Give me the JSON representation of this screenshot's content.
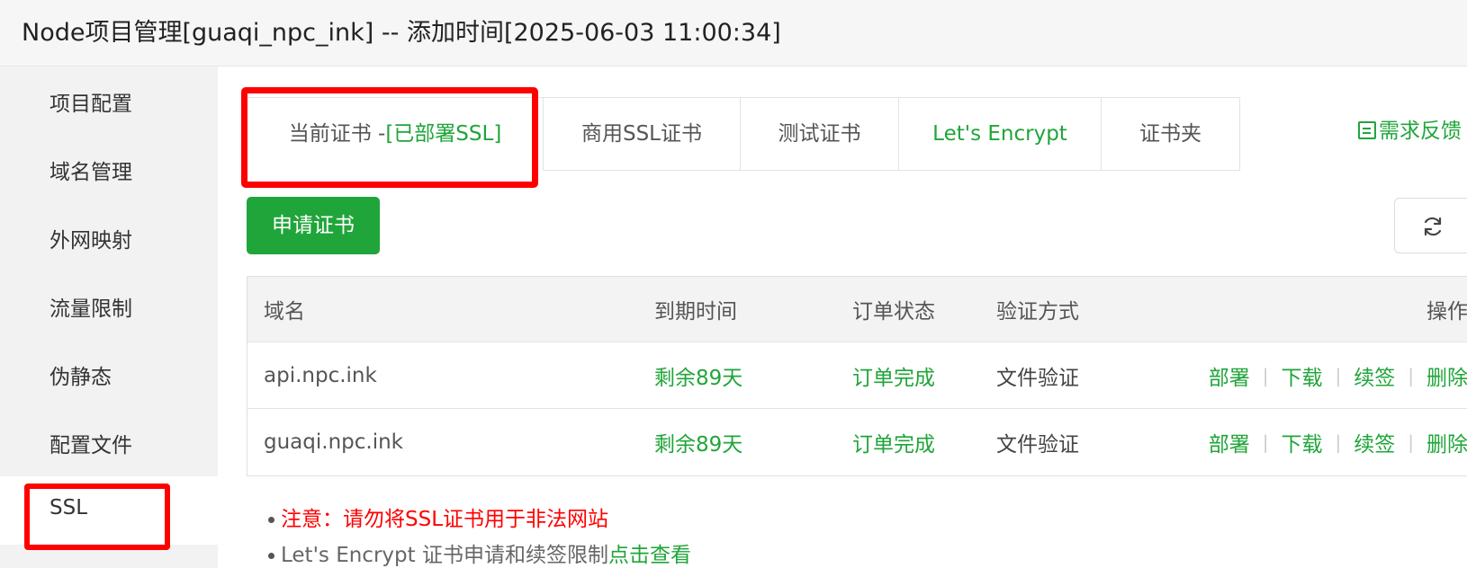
{
  "window": {
    "title": "Node项目管理[guaqi_npc_ink] -- 添加时间[2025-06-03 11:00:34]"
  },
  "sidebar": {
    "items": [
      {
        "label": "项目配置"
      },
      {
        "label": "域名管理"
      },
      {
        "label": "外网映射"
      },
      {
        "label": "流量限制"
      },
      {
        "label": "伪静态"
      },
      {
        "label": "配置文件"
      },
      {
        "label": "SSL"
      }
    ],
    "active": "SSL"
  },
  "tabs": {
    "current_prefix": "当前证书 -",
    "current_status": "[已部署SSL]",
    "commercial": "商用SSL证书",
    "test": "测试证书",
    "letsencrypt": "Let's Encrypt",
    "folder": "证书夹",
    "feedback": "需求反馈"
  },
  "toolbar": {
    "apply_label": "申请证书",
    "refresh_icon": "refresh-icon"
  },
  "table": {
    "headers": {
      "domain": "域名",
      "expire": "到期时间",
      "status": "订单状态",
      "verify": "验证方式",
      "ops": "操作"
    },
    "rows": [
      {
        "domain": "api.npc.ink",
        "expire": "剩余89天",
        "status": "订单完成",
        "verify": "文件验证"
      },
      {
        "domain": "guaqi.npc.ink",
        "expire": "剩余89天",
        "status": "订单完成",
        "verify": "文件验证"
      }
    ],
    "ops": {
      "deploy": "部署",
      "download": "下载",
      "renew": "续签",
      "delete": "删除"
    }
  },
  "notes": {
    "warning": "注意：请勿将SSL证书用于非法网站",
    "info_text": "Let's Encrypt 证书申请和续签限制",
    "info_link": "点击查看"
  },
  "colors": {
    "accent": "#20a53a",
    "highlight_box": "#ff0000"
  }
}
